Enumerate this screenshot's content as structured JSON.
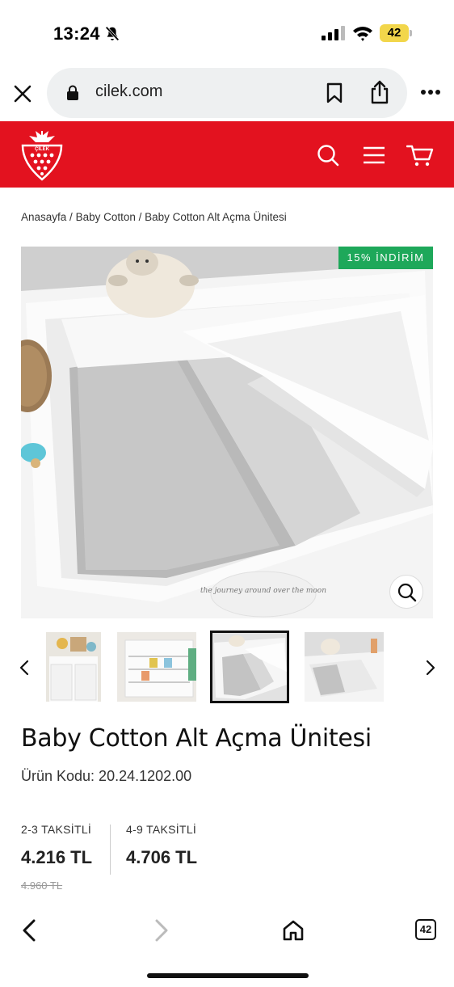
{
  "status_bar": {
    "time": "13:24",
    "battery": "42",
    "icons": [
      "bell-slash-icon",
      "signal-icon",
      "wifi-icon",
      "battery-icon"
    ]
  },
  "browser": {
    "domain": "cilek.com",
    "tabs_count": "42",
    "icons": [
      "close-icon",
      "lock-icon",
      "bookmark-icon",
      "share-icon",
      "more-icon"
    ]
  },
  "site_header": {
    "brand_color": "#e3121f",
    "logo_text": "ÇİLEK",
    "icons": [
      "search-icon",
      "menu-icon",
      "cart-icon"
    ]
  },
  "breadcrumb": {
    "items": [
      "Anasayfa",
      "Baby Cotton",
      "Baby Cotton Alt Açma Ünitesi"
    ],
    "separator": " / "
  },
  "product": {
    "discount_badge": "15% İNDİRİM",
    "discount_color": "#1ea85a",
    "title": "Baby Cotton Alt Açma Ünitesi",
    "code": "Ürün Kodu: 20.24.1202.00",
    "image_text": "the journey around over the moon",
    "thumbnails_count": 4,
    "active_thumbnail": 3
  },
  "pricing": {
    "option1": {
      "label": "2-3 TAKSİTLİ",
      "price": "4.216 TL",
      "old_price": "4.960 TL"
    },
    "option2": {
      "label": "4-9 TAKSİTLİ",
      "price": "4.706 TL"
    }
  },
  "bottom_bar": {
    "icons": [
      "back-icon",
      "forward-icon",
      "home-icon",
      "tabs-icon"
    ]
  }
}
